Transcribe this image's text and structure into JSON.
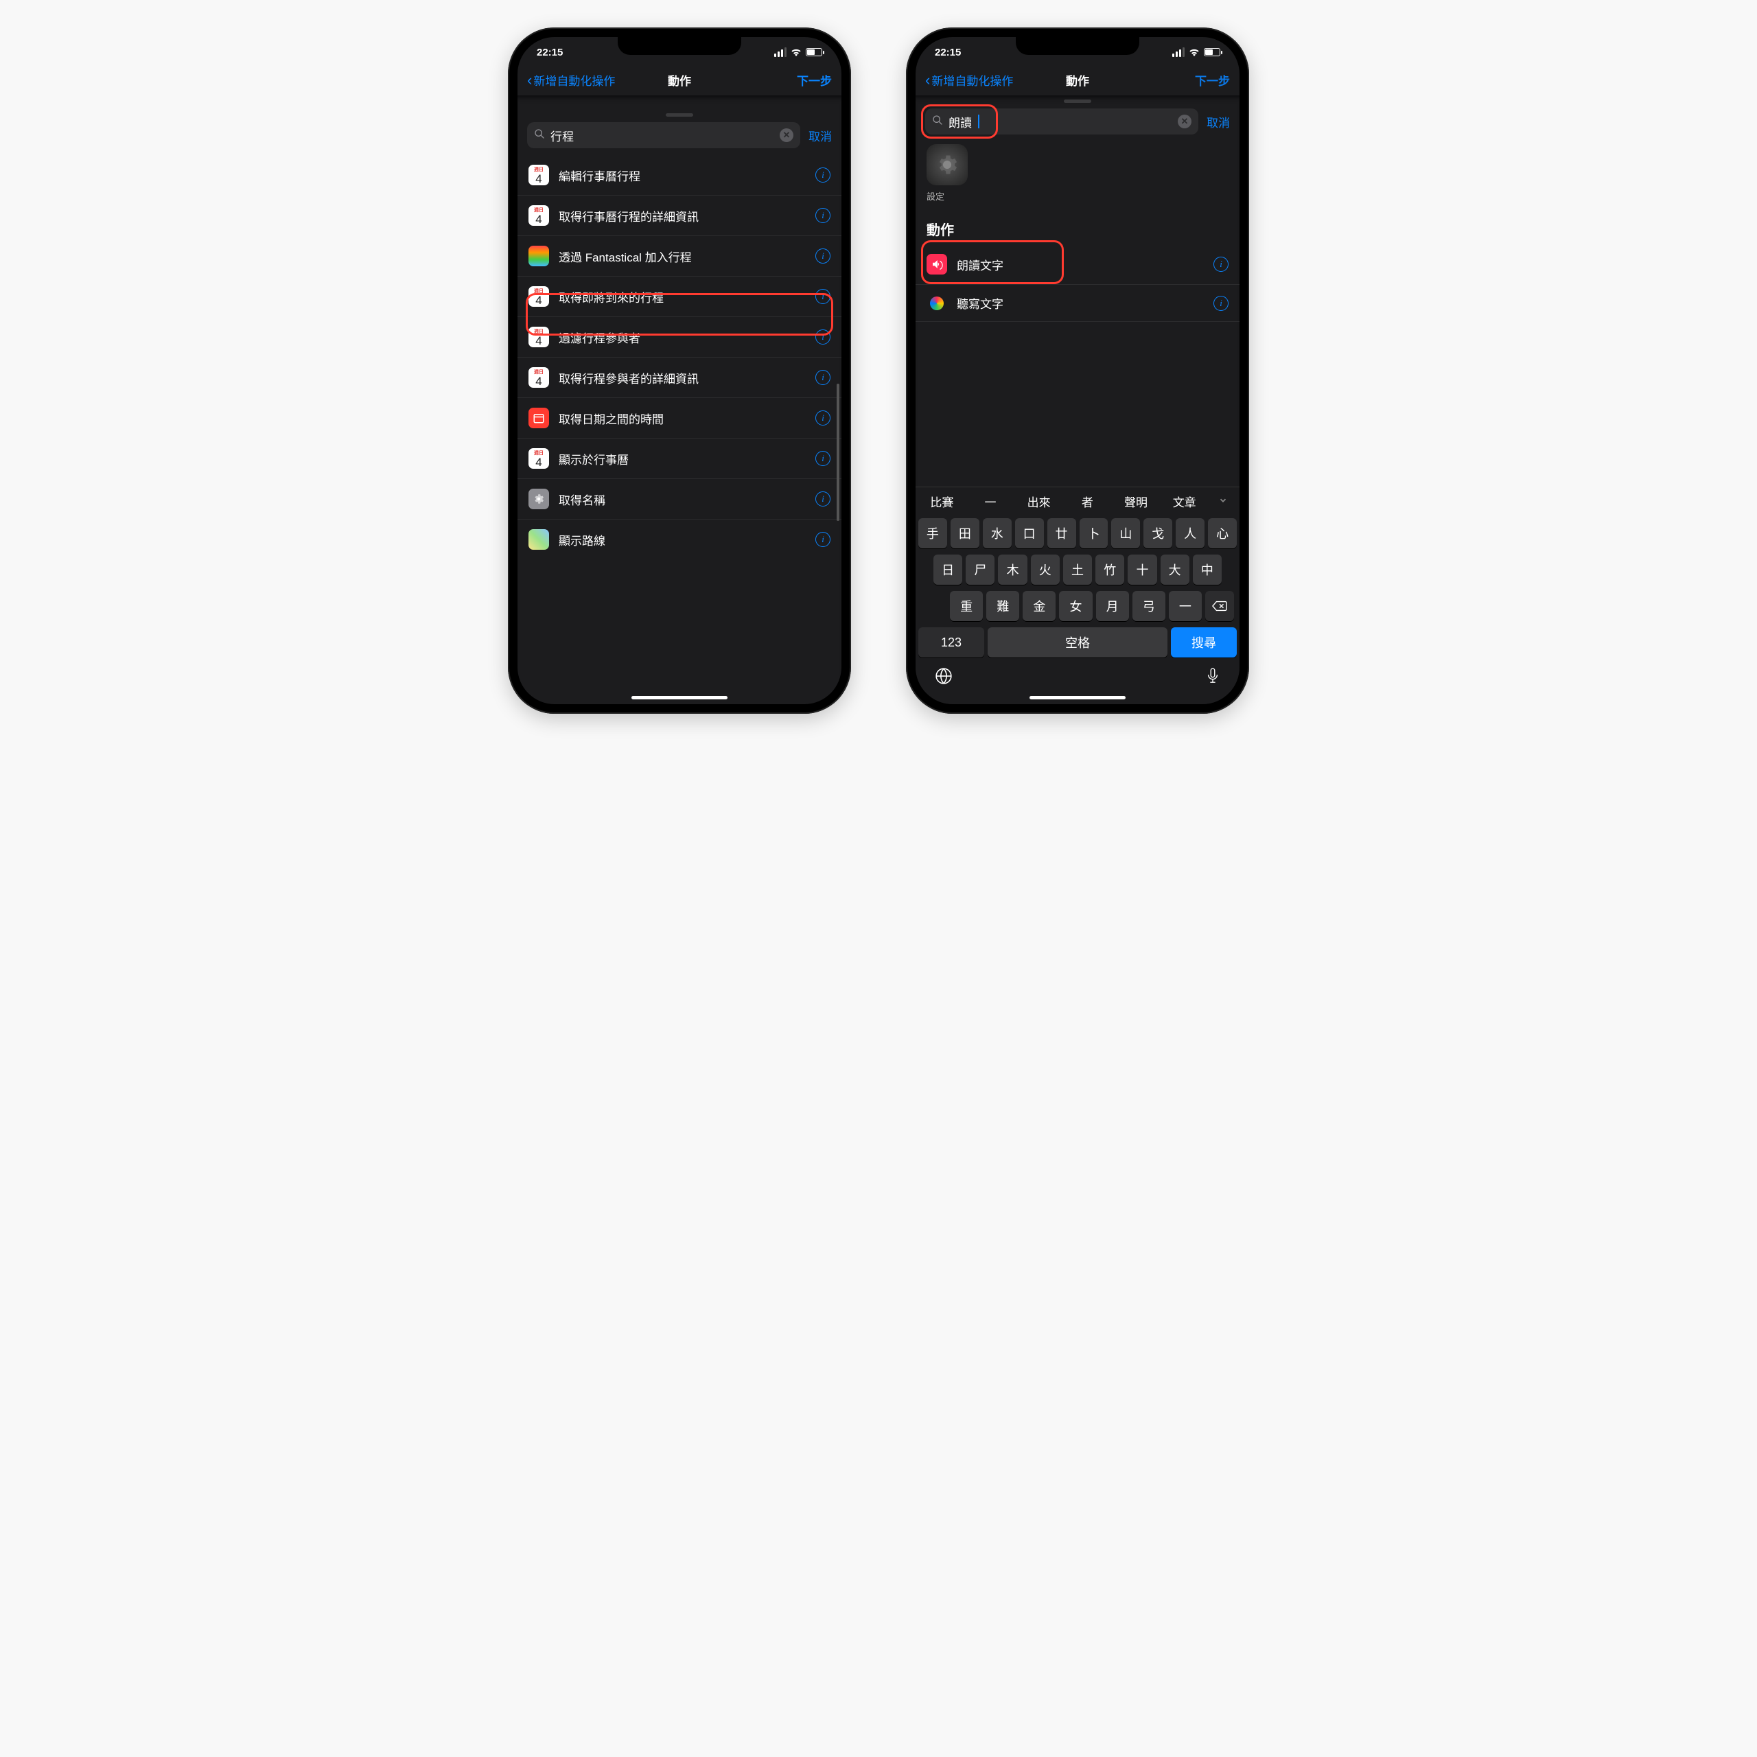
{
  "status": {
    "time": "22:15"
  },
  "nav": {
    "back": "新增自動化操作",
    "title": "動作",
    "next": "下一步"
  },
  "search1": {
    "query": "行程",
    "cancel": "取消"
  },
  "left_items": [
    {
      "label": "編輯行事曆行程",
      "icon": "calendar"
    },
    {
      "label": "取得行事曆行程的詳細資訊",
      "icon": "calendar"
    },
    {
      "label": "透過 Fantastical 加入行程",
      "icon": "fantastical"
    },
    {
      "label": "取得即將到來的行程",
      "icon": "calendar"
    },
    {
      "label": "過濾行程參與者",
      "icon": "calendar"
    },
    {
      "label": "取得行程參與者的詳細資訊",
      "icon": "calendar"
    },
    {
      "label": "取得日期之間的時間",
      "icon": "red-cal"
    },
    {
      "label": "顯示於行事曆",
      "icon": "calendar"
    },
    {
      "label": "取得名稱",
      "icon": "gear"
    },
    {
      "label": "顯示路線",
      "icon": "map"
    }
  ],
  "calendar_day": "4",
  "calendar_dayname": "週日",
  "search2": {
    "query": "朗讀",
    "cancel": "取消"
  },
  "right_app": {
    "label": "設定"
  },
  "right_section": "動作",
  "right_items": [
    {
      "label": "朗讀文字",
      "icon": "speak"
    },
    {
      "label": "聽寫文字",
      "icon": "siri"
    }
  ],
  "candidates": [
    "比賽",
    "一",
    "出來",
    "者",
    "聲明",
    "文章"
  ],
  "keys_row1": [
    "手",
    "田",
    "水",
    "口",
    "廿",
    "卜",
    "山",
    "戈",
    "人",
    "心"
  ],
  "keys_row2": [
    "日",
    "尸",
    "木",
    "火",
    "土",
    "竹",
    "十",
    "大",
    "中"
  ],
  "keys_row3": [
    "重",
    "難",
    "金",
    "女",
    "月",
    "弓",
    "一"
  ],
  "key_123": "123",
  "key_space": "空格",
  "key_search": "搜尋"
}
